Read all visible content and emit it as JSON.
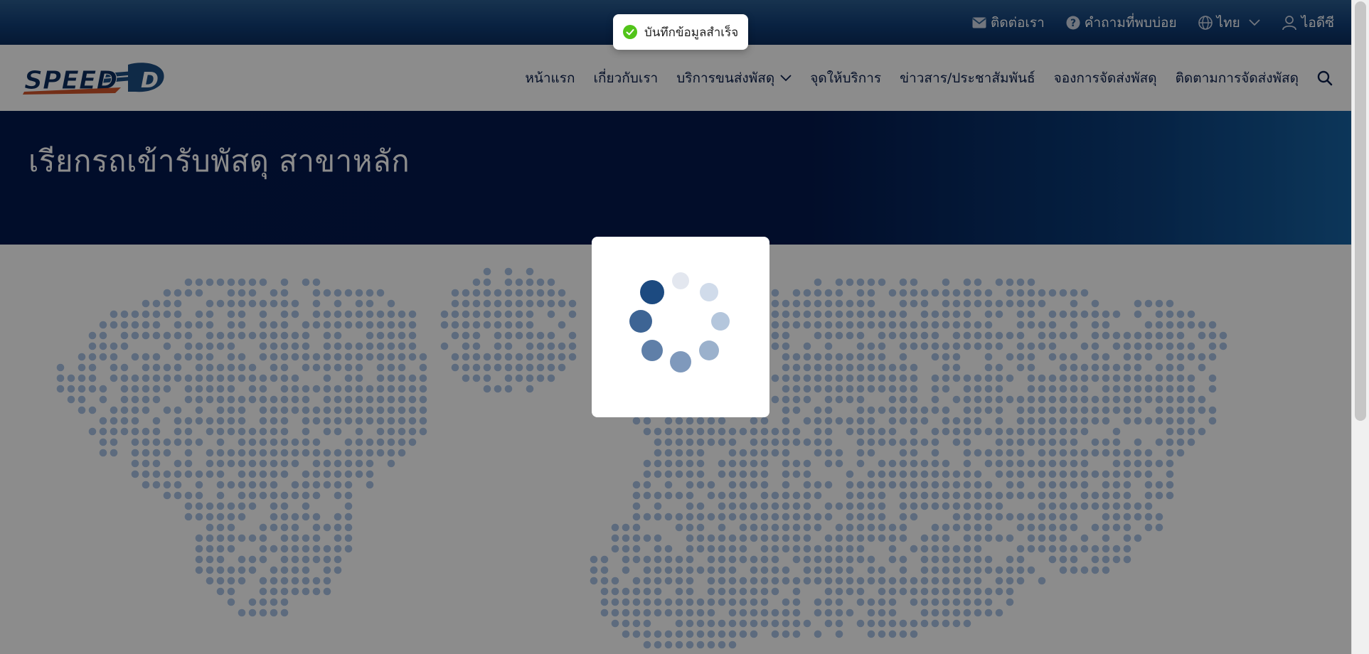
{
  "topbar": {
    "contact_label": "ติดต่อเรา",
    "faq_label": "คำถามที่พบบ่อย",
    "language_label": "ไทย",
    "account_label": "ไอดีซี"
  },
  "brand": {
    "logo_text": "SPEED D",
    "primary_color": "#0b2d5e",
    "accent_color": "#d2562c"
  },
  "nav": {
    "items": [
      {
        "label": "หน้าแรก"
      },
      {
        "label": "เกี่ยวกับเรา"
      },
      {
        "label": "บริการขนส่งพัสดุ",
        "has_dropdown": true
      },
      {
        "label": "จุดให้บริการ"
      },
      {
        "label": "ข่าวสาร/ประชาสัมพันธ์"
      },
      {
        "label": "จองการจัดส่งพัสดุ"
      },
      {
        "label": "ติดตามการจัดส่งพัสดุ"
      }
    ],
    "search_icon": "search-icon"
  },
  "banner": {
    "title": "เรียกรถเข้ารับพัสดุ สาขาหลัก"
  },
  "toast": {
    "message": "บันทึกข้อมูลสำเร็จ",
    "status_color": "#52c41a"
  },
  "loading": {
    "spinner": "dot-spinner"
  },
  "map": {
    "dot_color": "#a9c4e6"
  }
}
